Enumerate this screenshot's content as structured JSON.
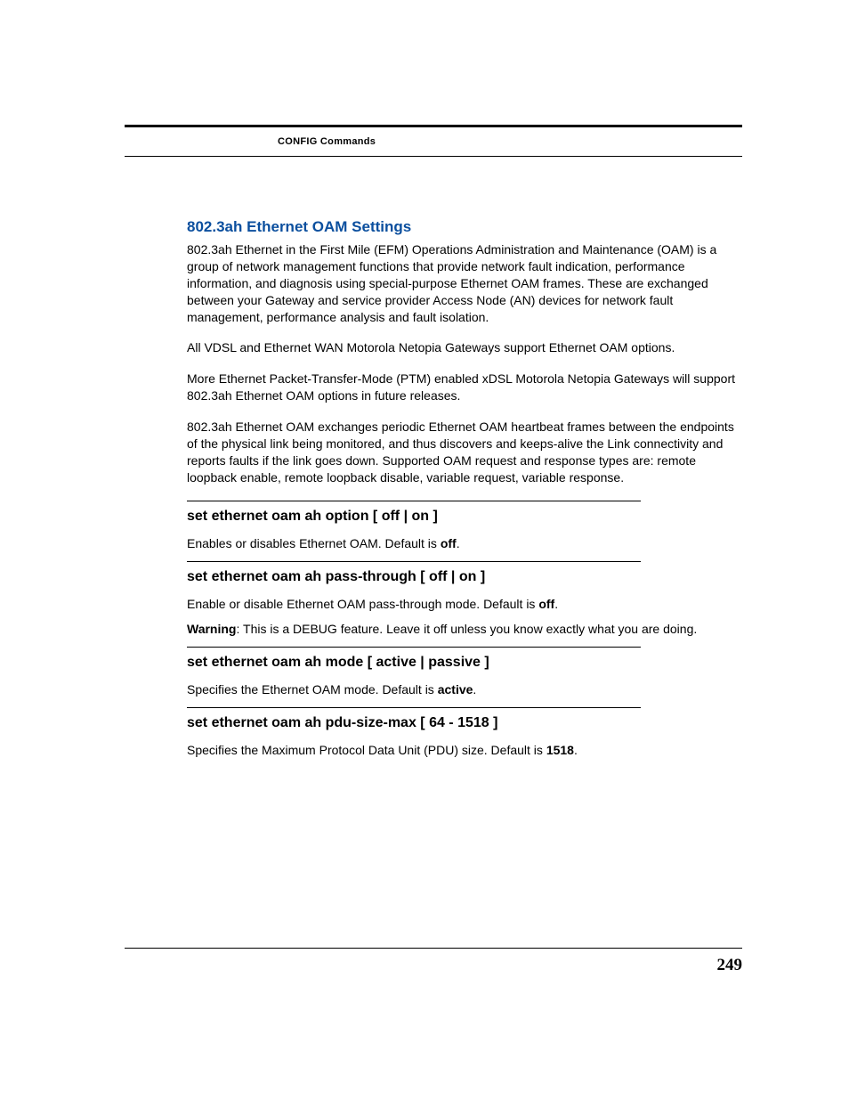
{
  "header": {
    "label": "CONFIG Commands"
  },
  "section": {
    "title": "802.3ah Ethernet OAM Settings",
    "paras": [
      "802.3ah Ethernet in the First Mile (EFM) Operations Administration and Maintenance (OAM) is a group of network management functions that provide network fault indication, performance information, and diagnosis using special-purpose Ethernet OAM frames. These are exchanged between your Gateway and service provider Access Node (AN) devices for network fault management, performance analysis and fault isolation.",
      "All VDSL and Ethernet WAN Motorola Netopia Gateways support Ethernet OAM options.",
      "More Ethernet Packet-Transfer-Mode (PTM) enabled xDSL Motorola Netopia Gateways will support 802.3ah Ethernet OAM options in future releases.",
      "802.3ah Ethernet OAM exchanges periodic Ethernet OAM heartbeat frames between the endpoints of the physical link being monitored, and thus discovers and keeps-alive the Link connectivity and reports faults if the link goes down. Supported OAM request and response types are: remote loopback enable, remote loopback disable, variable request, variable response."
    ]
  },
  "commands": [
    {
      "title": "set ethernet oam ah option [ off | on ]",
      "desc_pre": "Enables or disables Ethernet OAM. Default is ",
      "desc_bold": "off",
      "desc_post": "."
    },
    {
      "title": "set ethernet oam ah pass-through [ off | on ]",
      "desc_pre": "Enable or disable Ethernet OAM pass-through mode. Default is ",
      "desc_bold": "off",
      "desc_post": ".",
      "warn_label": "Warning",
      "warn_text": ": This is a DEBUG feature. Leave it off unless you know exactly what you are doing."
    },
    {
      "title": "set ethernet oam ah mode [ active | passive ]",
      "desc_pre": "Specifies the Ethernet OAM mode. Default is ",
      "desc_bold": "active",
      "desc_post": "."
    },
    {
      "title": "set ethernet oam ah pdu-size-max [ 64 - 1518 ]",
      "desc_pre": "Specifies the Maximum Protocol Data Unit (PDU) size. Default is ",
      "desc_bold": "1518",
      "desc_post": "."
    }
  ],
  "page_number": "249"
}
